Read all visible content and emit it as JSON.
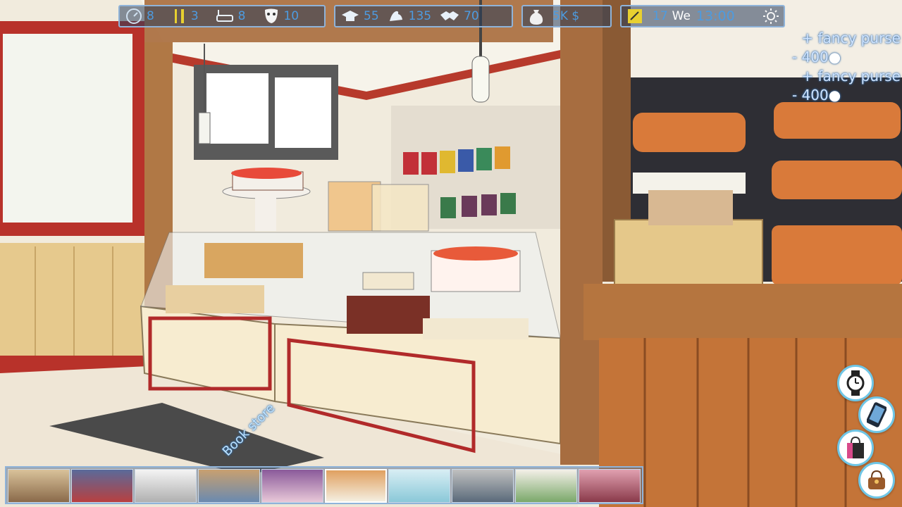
{
  "hud": {
    "needs": {
      "energy": "8",
      "food": "3",
      "hygiene": "8",
      "mood": "10"
    },
    "skills": {
      "education": "55",
      "strength": "135",
      "social": "70"
    },
    "money": "5K $",
    "clock": {
      "day_num": "17",
      "weekday": "We",
      "time": "13:00"
    }
  },
  "notifications": [
    {
      "item": "+ fancy purse",
      "cost": "- 400"
    },
    {
      "item": "+ fancy purse",
      "cost": "- 400"
    }
  ],
  "map_label": "Book store",
  "side_buttons": [
    "watch-icon",
    "phone-icon",
    "shopping-bag-icon",
    "handbag-icon"
  ],
  "locations": [
    "mall",
    "arcade",
    "clothing-store",
    "book-store",
    "bedroom",
    "bakery",
    "clinic",
    "office",
    "cafe",
    "shoe-store"
  ]
}
